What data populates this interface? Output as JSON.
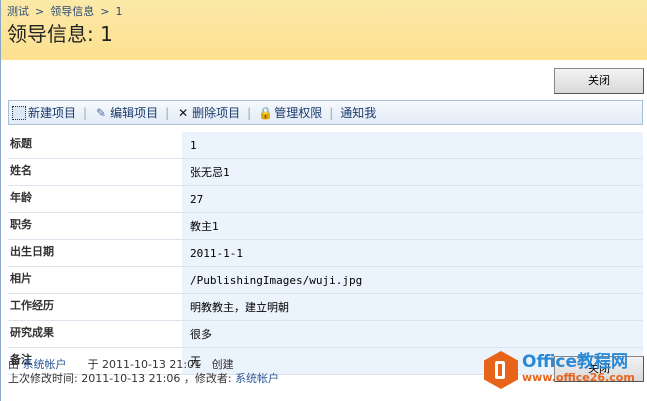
{
  "breadcrumb": [
    "测试",
    "领导信息",
    "1"
  ],
  "breadcrumb_sep": ">",
  "title": "领导信息: 1",
  "close_label": "关闭",
  "toolbar": [
    {
      "label": "新建项目",
      "icon": "new-item-icon"
    },
    {
      "label": "编辑项目",
      "icon": "edit-item-icon"
    },
    {
      "label": "删除项目",
      "icon": "delete-icon"
    },
    {
      "label": "管理权限",
      "icon": "permissions-icon"
    },
    {
      "label": "通知我",
      "icon": ""
    }
  ],
  "fields": [
    {
      "label": "标题",
      "value": "1"
    },
    {
      "label": "姓名",
      "value": "张无忌1"
    },
    {
      "label": "年龄",
      "value": "27"
    },
    {
      "label": "职务",
      "value": "教主1"
    },
    {
      "label": "出生日期",
      "value": "2011-1-1"
    },
    {
      "label": "相片",
      "value": "/PublishingImages/wuji.jpg"
    },
    {
      "label": "工作经历",
      "value": "明教教主，建立明朝"
    },
    {
      "label": "研究成果",
      "value": "很多"
    },
    {
      "label": "备注",
      "value": "无"
    }
  ],
  "footer": {
    "created_by_prefix": "由",
    "created_by": "系统帐户",
    "created_at_prefix": "于",
    "created_at": "2011-10-13 21:01",
    "created_suffix": "创建",
    "modified_prefix": "上次修改时间:",
    "modified_at": "2011-10-13 21:06",
    "modified_by_prefix": "，修改者:",
    "modified_by": "系统帐户"
  },
  "watermark": {
    "name": "Office教程网",
    "url": "www.office26.com"
  }
}
